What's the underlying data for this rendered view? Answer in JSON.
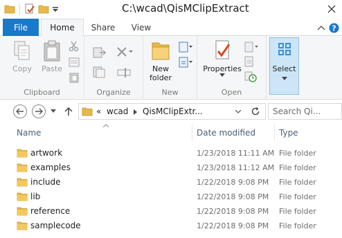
{
  "window": {
    "title": "C:\\wcad\\QisMClipExtract"
  },
  "tabs": {
    "file": "File",
    "home": "Home",
    "share": "Share",
    "view": "View"
  },
  "ribbon": {
    "clipboard": {
      "copy": "Copy",
      "paste": "Paste",
      "group": "Clipboard"
    },
    "organize": {
      "group": "Organize"
    },
    "new": {
      "new_folder_line1": "New",
      "new_folder_line2": "folder",
      "group": "New"
    },
    "open": {
      "properties": "Properties",
      "group": "Open"
    },
    "select": {
      "label": "Select"
    }
  },
  "address": {
    "overflow": "«",
    "crumb1": "wcad",
    "crumb2": "QisMClipExtr...",
    "search_placeholder": "Search Qi..."
  },
  "columns": {
    "name": "Name",
    "date": "Date modified",
    "type": "Type"
  },
  "files": [
    {
      "name": "artwork",
      "date": "1/23/2018 11:11 AM",
      "type": "File folder"
    },
    {
      "name": "examples",
      "date": "1/23/2018 11:12 AM",
      "type": "File folder"
    },
    {
      "name": "include",
      "date": "1/22/2018 9:08 PM",
      "type": "File folder"
    },
    {
      "name": "lib",
      "date": "1/22/2018 9:08 PM",
      "type": "File folder"
    },
    {
      "name": "reference",
      "date": "1/22/2018 9:08 PM",
      "type": "File folder"
    },
    {
      "name": "samplecode",
      "date": "1/22/2018 9:08 PM",
      "type": "File folder"
    }
  ],
  "colors": {
    "accent": "#1979ca",
    "folder": "#e8b84a",
    "ribbon_bg": "#f5f6f7"
  }
}
